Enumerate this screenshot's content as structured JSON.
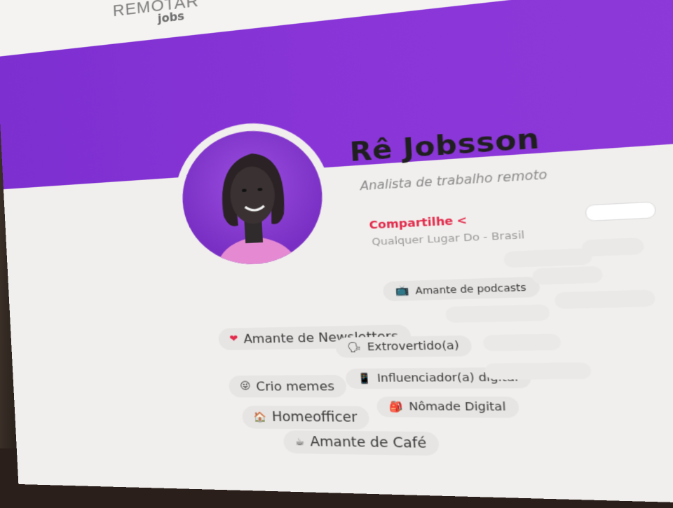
{
  "brand": {
    "logo_top": "REMOTAR",
    "logo_bottom": "jobs"
  },
  "nav": {
    "cta_color": "#e2293f"
  },
  "profile": {
    "name": "Rê Jobsson",
    "title": "Analista de trabalho remoto",
    "share_label": "Compartilhe",
    "share_icon": "share-icon",
    "location": "Qualquer Lugar Do - Brasil",
    "banner_color": "#8a35d8",
    "accent_color": "#e2294a"
  },
  "tags": [
    {
      "icon": "❤",
      "label": "Amante de Newsletters"
    },
    {
      "icon": "📺",
      "label": "Amante de podcasts"
    },
    {
      "icon": "🗣",
      "label": "Extrovertido(a)"
    },
    {
      "icon": "😜",
      "label": "Crio memes"
    },
    {
      "icon": "📱",
      "label": "Influenciador(a) digital"
    },
    {
      "icon": "🏠",
      "label": "Homeofficer"
    },
    {
      "icon": "🎒",
      "label": "Nômade Digital"
    },
    {
      "icon": "☕",
      "label": "Amante de Café"
    }
  ]
}
